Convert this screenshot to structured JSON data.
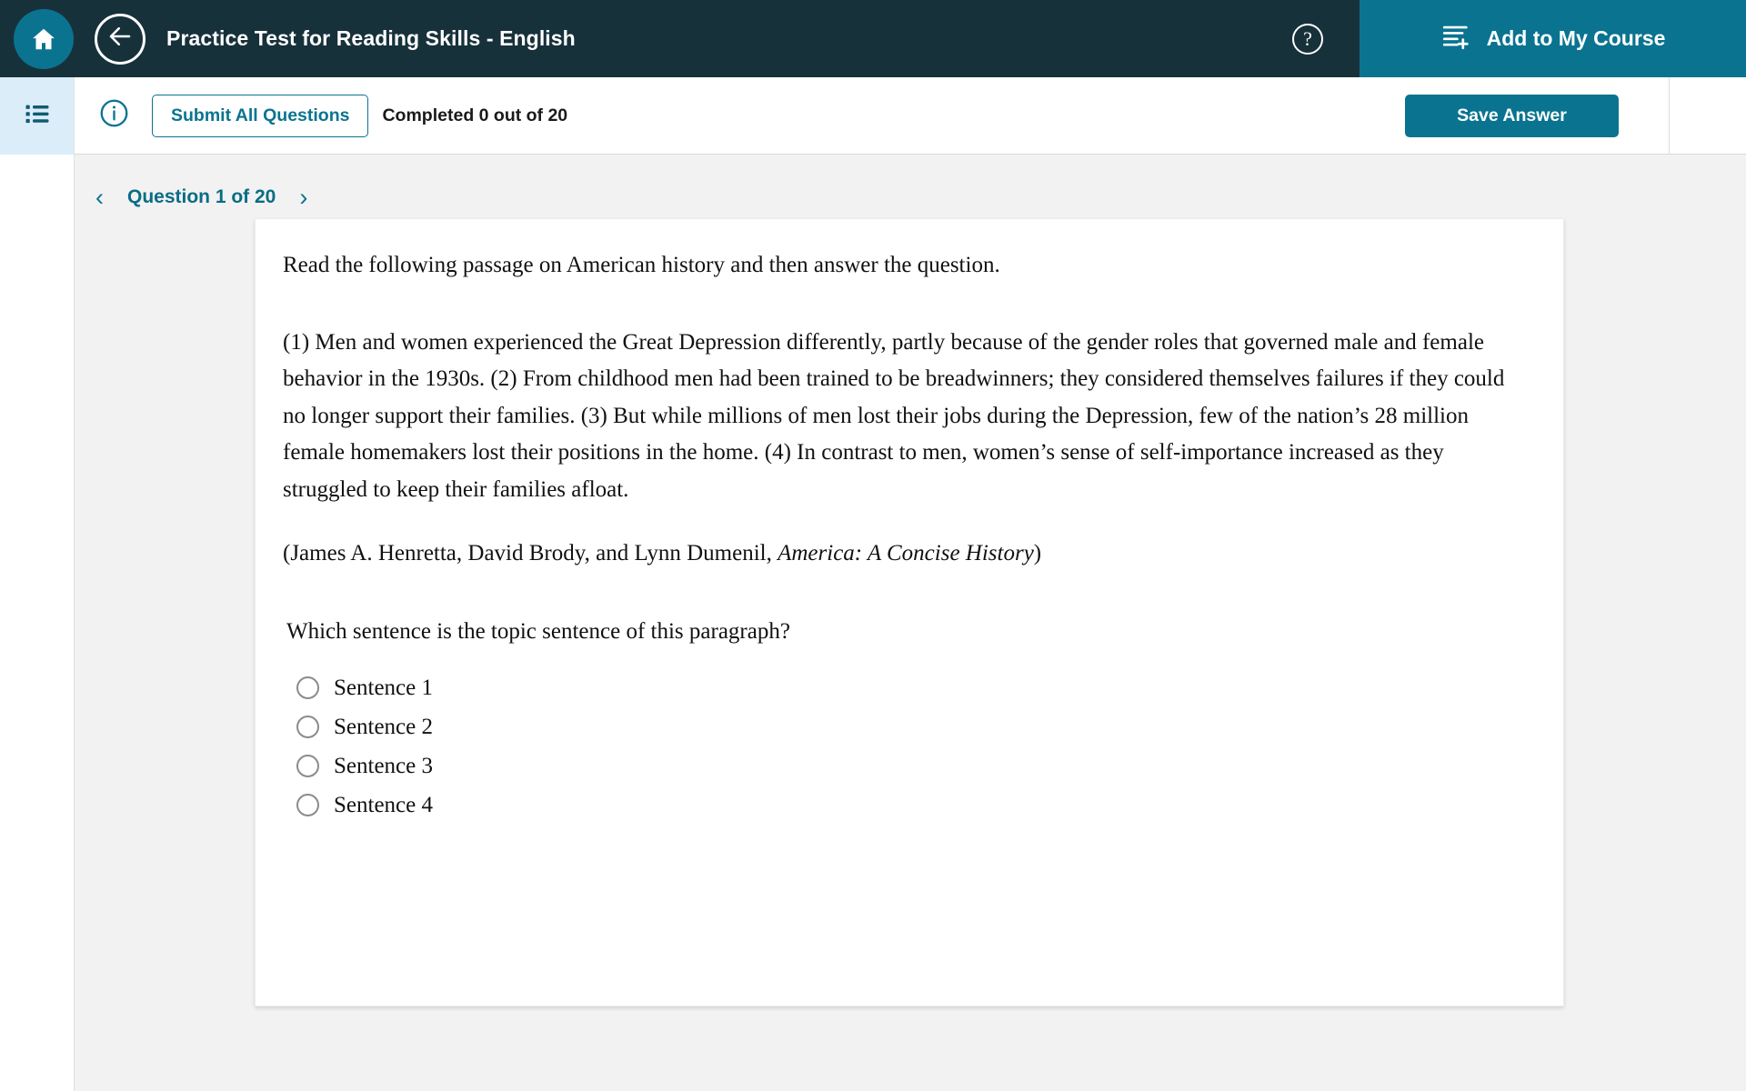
{
  "header": {
    "home_icon": "home-icon",
    "back_icon": "back-arrow-icon",
    "title": "Practice Test for Reading Skills - English",
    "help_icon": "question-mark-icon",
    "help_glyph": "?",
    "add_to_course_icon": "list-add-icon",
    "add_to_course_label": "Add to My Course",
    "accent_color": "#0a7390",
    "bar_color": "#17313b"
  },
  "toolbar": {
    "sidebar_toggle_icon": "list-menu-icon",
    "info_icon": "info-circle-icon",
    "submit_all_label": "Submit All Questions",
    "completed_status": "Completed 0 out of 20",
    "save_answer_label": "Save Answer"
  },
  "question_nav": {
    "prev_arrow": "‹",
    "next_arrow": "›",
    "label": "Question 1 of 20"
  },
  "question": {
    "intro": "Read the following passage on American history and then answer the question.",
    "passage": "(1) Men and women experienced the Great Depression differently, partly because of the gender roles that governed male and female behavior in the 1930s. (2) From childhood men had been trained to be breadwinners; they considered themselves failures if they could no longer support their families. (3) But while millions of men lost their jobs during the Depression, few of the nation’s 28 million female homemakers lost their positions in the home. (4) In contrast to men, women’s sense of self-importance increased as they struggled to keep their families afloat.",
    "citation_prefix": "(James A. Henretta, David Brody, and Lynn Dumenil, ",
    "citation_title": "America: A Concise History",
    "citation_suffix": ")",
    "prompt": "Which sentence is the topic sentence of this paragraph?",
    "options": [
      {
        "label": "Sentence 1",
        "selected": false
      },
      {
        "label": "Sentence 2",
        "selected": false
      },
      {
        "label": "Sentence 3",
        "selected": false
      },
      {
        "label": "Sentence 4",
        "selected": false
      }
    ]
  }
}
